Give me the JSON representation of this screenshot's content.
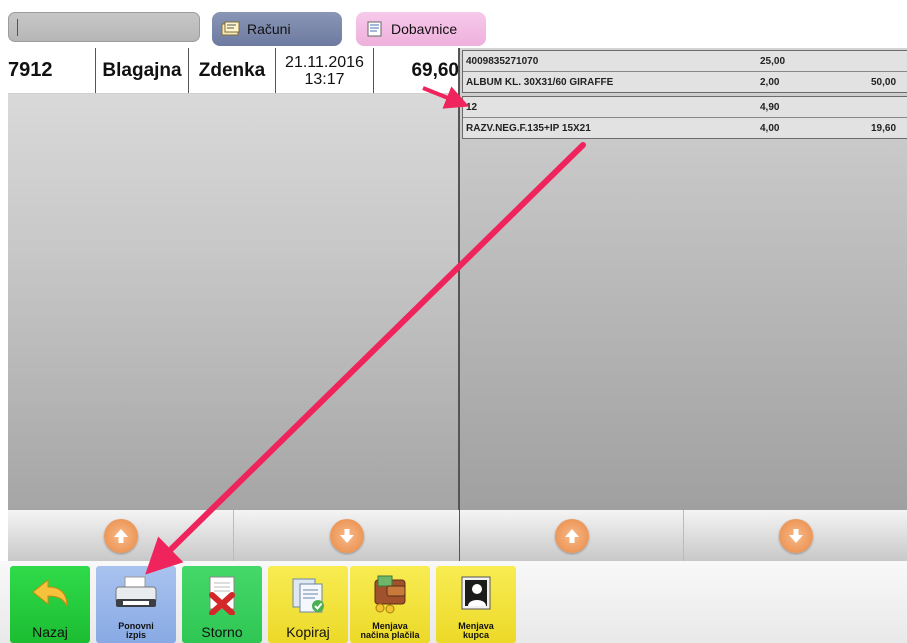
{
  "header": {
    "search_value": "",
    "tabs": [
      {
        "label": "Računi"
      },
      {
        "label": "Dobavnice"
      }
    ]
  },
  "receipt": {
    "number": "7912",
    "register": "Blagajna",
    "cashier": "Zdenka",
    "date": "21.11.2016",
    "time": "13:17",
    "total": "69,60"
  },
  "items": [
    {
      "lines": [
        {
          "name": "4009835271070",
          "qty": "25,00",
          "amount": ""
        },
        {
          "name": "ALBUM KL. 30X31/60 GIRAFFE",
          "qty": "2,00",
          "amount": "50,00"
        }
      ]
    },
    {
      "lines": [
        {
          "name": "12",
          "qty": "4,90",
          "amount": ""
        },
        {
          "name": "RAZV.NEG.F.135+IP 15X21",
          "qty": "4,00",
          "amount": "19,60"
        }
      ]
    }
  ],
  "toolbar": {
    "nazaj": "Nazaj",
    "ponovni_line1": "Ponovni",
    "ponovni_line2": "izpis",
    "storno": "Storno",
    "kopiraj": "Kopiraj",
    "menjava_placila_line1": "Menjava",
    "menjava_placila_line2": "načina plačila",
    "menjava_kupca_line1": "Menjava",
    "menjava_kupca_line2": "kupca"
  },
  "colors": {
    "annotation_arrow": "#f0245c",
    "scroll_arrow": "#e98843",
    "tab_racuni": "#7985aa",
    "tab_dobavnice": "#f2bce2"
  }
}
